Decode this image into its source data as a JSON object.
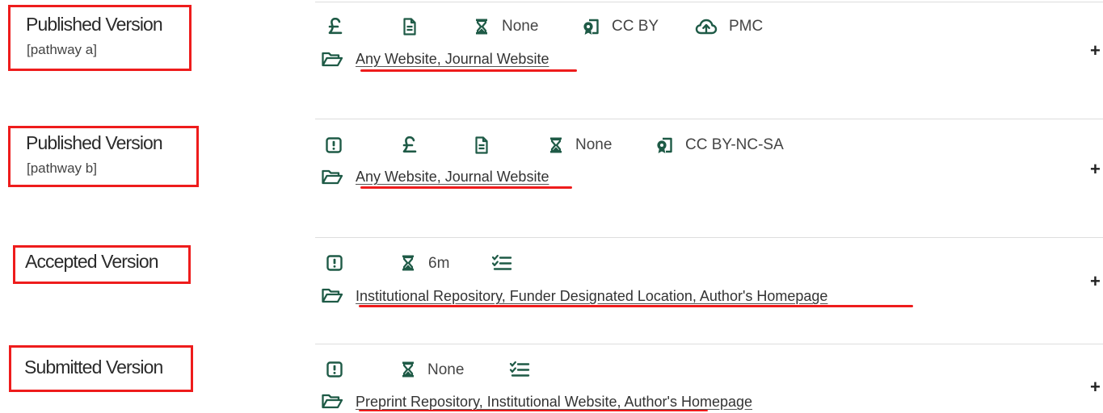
{
  "rows": [
    {
      "title": "Published Version",
      "pathway": "[pathway a]",
      "embargo": "None",
      "license": "CC BY",
      "deposit": "PMC",
      "locations": "Any Website, Journal Website",
      "expand_label": "+"
    },
    {
      "title": "Published Version",
      "pathway": "[pathway b]",
      "embargo": "None",
      "license": "CC BY-NC-SA",
      "locations": "Any Website, Journal Website",
      "expand_label": "+"
    },
    {
      "title": "Accepted Version",
      "embargo": "6m",
      "locations": "Institutional Repository, Funder Designated Location, Author's Homepage",
      "expand_label": "+"
    },
    {
      "title": "Submitted Version",
      "embargo": "None",
      "locations": "Preprint Repository, Institutional Website, Author's Homepage",
      "expand_label": "+"
    }
  ],
  "colors": {
    "icon": "#1e5a46",
    "annotation_red": "#ee1c1c",
    "divider": "#dddddd"
  },
  "icons": [
    "pound-icon",
    "document-icon",
    "hourglass-icon",
    "license-icon",
    "cloud-upload-icon",
    "alert-icon",
    "checklist-icon",
    "folder-icon"
  ]
}
